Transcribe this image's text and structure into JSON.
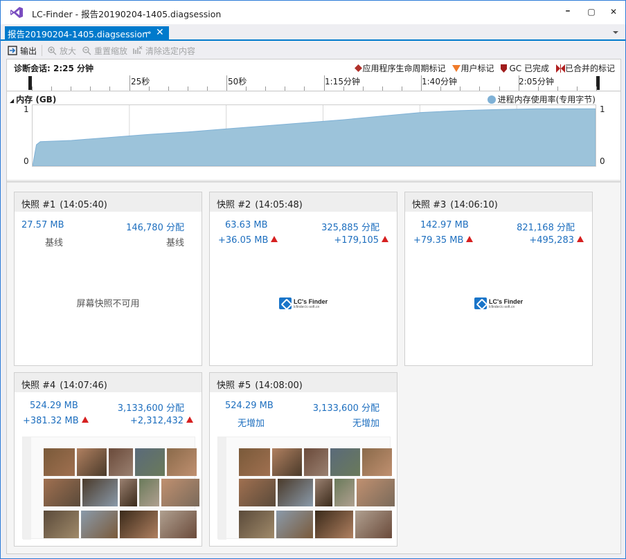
{
  "window": {
    "title": "LC-Finder - 报告20190204-1405.diagsession",
    "minimize": "━",
    "maximize": "▢",
    "close": "✕"
  },
  "tab": {
    "label": "报告20190204-1405.diagsession",
    "pin": "⊸",
    "close": "✕"
  },
  "toolbar": {
    "output": "输出",
    "zoom_in": "放大",
    "reset_zoom": "重置缩放",
    "clear_selection": "清除选定内容"
  },
  "session": {
    "label": "诊断会话: 2:25 分钟",
    "legend": [
      {
        "label": "应用程序生命周期标记",
        "color": "#c0392b"
      },
      {
        "label": "用户标记",
        "color": "#f07b2a"
      },
      {
        "label": "GC 已完成",
        "color": "#b02020"
      },
      {
        "label": "已合并的标记",
        "color": "#b02020"
      }
    ]
  },
  "ruler": {
    "labels": [
      "25秒",
      "50秒",
      "1:15分钟",
      "1:40分钟",
      "2:05分钟"
    ]
  },
  "memory": {
    "title": "内存 (GB)",
    "legend": "进程内存使用率(专用字节)",
    "y_max_label": "1",
    "y_min_label": "0",
    "color": "#9cc3da"
  },
  "chart_data": {
    "type": "area",
    "title": "内存 (GB)",
    "x": [
      0,
      1,
      2,
      10,
      20,
      30,
      40,
      50,
      60,
      70,
      80,
      90,
      100,
      110,
      120,
      130,
      140,
      145
    ],
    "y": [
      0.0,
      0.35,
      0.4,
      0.42,
      0.47,
      0.52,
      0.56,
      0.61,
      0.66,
      0.71,
      0.76,
      0.82,
      0.88,
      0.91,
      0.93,
      0.94,
      0.94,
      0.94
    ],
    "ylim": [
      0,
      1
    ],
    "series": [
      {
        "name": "进程内存使用率(专用字节)",
        "values": [
          0.0,
          0.35,
          0.4,
          0.42,
          0.47,
          0.52,
          0.56,
          0.61,
          0.66,
          0.71,
          0.76,
          0.82,
          0.88,
          0.91,
          0.93,
          0.94,
          0.94,
          0.94
        ]
      }
    ],
    "grid": true
  },
  "snapshots": [
    {
      "name": "快照 #1",
      "time": "(14:05:40)",
      "size": "27.57 MB",
      "allocs": "146,780 分配",
      "size_delta": "基线",
      "allocs_delta": "基线",
      "delta_up": false,
      "image": "none",
      "no_image_text": "屏幕快照不可用"
    },
    {
      "name": "快照 #2",
      "time": "(14:05:48)",
      "size": "63.63 MB",
      "allocs": "325,885 分配",
      "size_delta": "+36.05 MB",
      "allocs_delta": "+179,105",
      "delta_up": true,
      "image": "logo"
    },
    {
      "name": "快照 #3",
      "time": "(14:06:10)",
      "size": "142.97 MB",
      "allocs": "821,168 分配",
      "size_delta": "+79.35 MB",
      "allocs_delta": "+495,283",
      "delta_up": true,
      "image": "logo"
    },
    {
      "name": "快照 #4",
      "time": "(14:07:46)",
      "size": "524.29 MB",
      "allocs": "3,133,600 分配",
      "size_delta": "+381.32 MB",
      "allocs_delta": "+2,312,432",
      "delta_up": true,
      "image": "photos"
    },
    {
      "name": "快照 #5",
      "time": "(14:08:00)",
      "size": "524.29 MB",
      "allocs": "3,133,600 分配",
      "size_delta": "无增加",
      "allocs_delta": "无增加",
      "delta_up": false,
      "image": "photos"
    }
  ],
  "logo": {
    "title": "LC's Finder",
    "subtitle": "lcfinder.lc-soft.cn"
  }
}
